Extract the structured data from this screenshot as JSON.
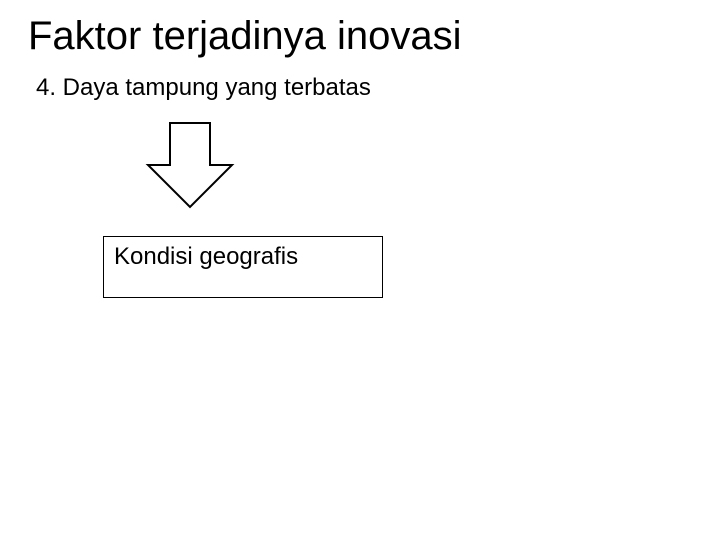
{
  "title": "Faktor terjadinya inovasi",
  "subtitle": "4. Daya tampung yang terbatas",
  "box_label": "Kondisi geografis"
}
